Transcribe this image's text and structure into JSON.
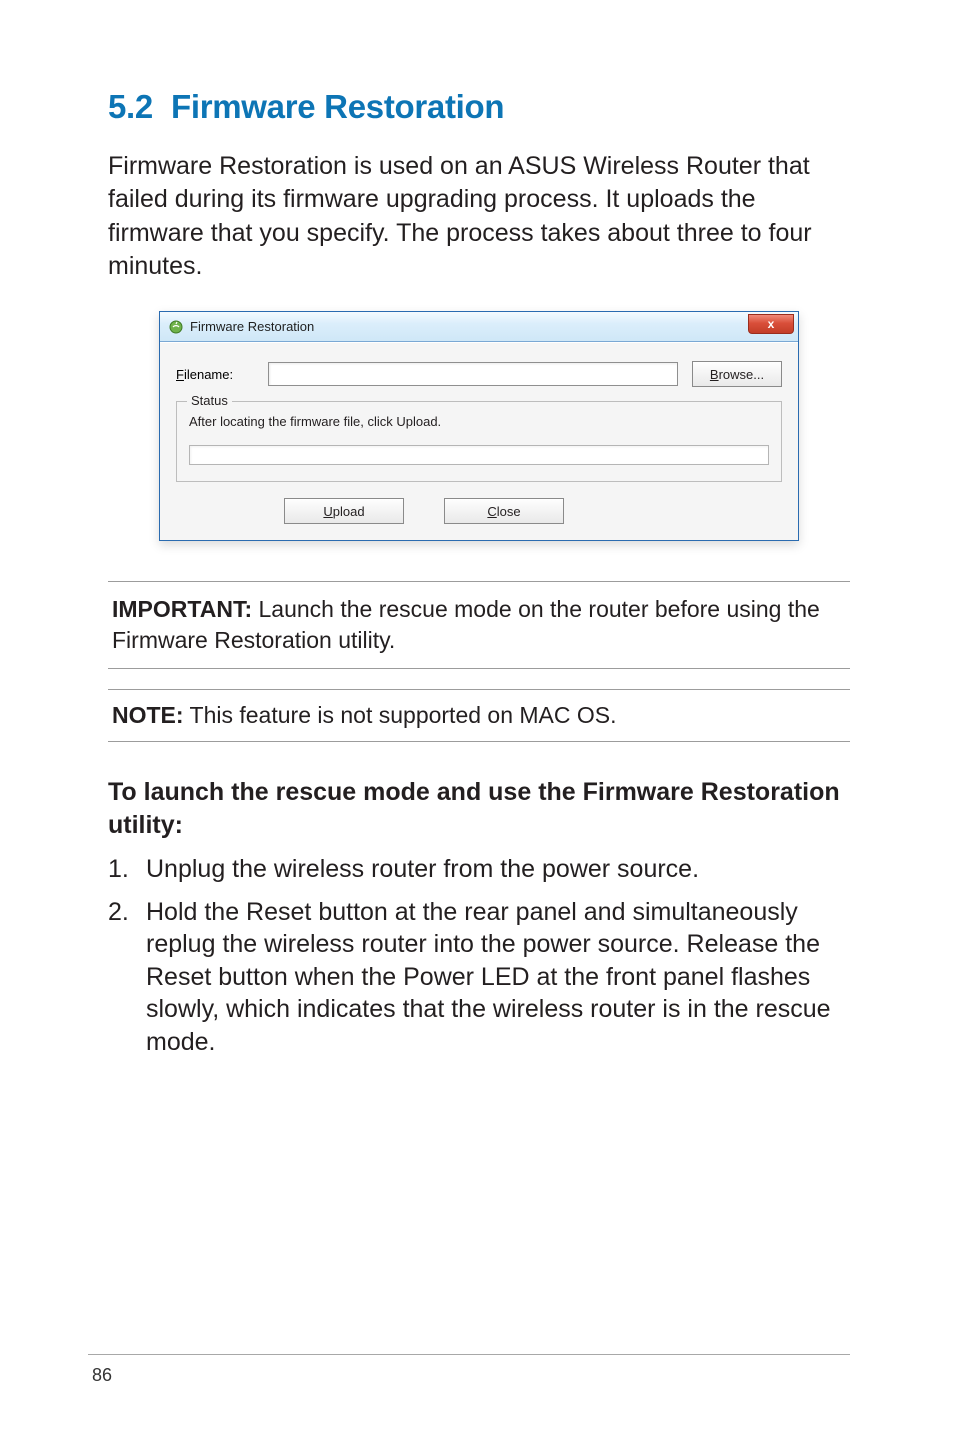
{
  "heading": {
    "number": "5.2",
    "title": "Firmware Restoration"
  },
  "intro": "Firmware Restoration is used on an ASUS Wireless Router that failed during its firmware upgrading process. It uploads the firmware that you specify. The process takes about three to four minutes.",
  "dialog": {
    "title": "Firmware Restoration",
    "filename_label_pre": "F",
    "filename_label_rest": "ilename:",
    "filename_value": "",
    "browse_pre": "B",
    "browse_rest": "rowse...",
    "status_legend": "Status",
    "status_text": "After locating the firmware file, click Upload.",
    "upload_pre": "U",
    "upload_rest": "pload",
    "close_pre": "C",
    "close_rest": "lose",
    "close_x": "x"
  },
  "important": {
    "label": "IMPORTANT:",
    "text": "  Launch the rescue mode on the router before using the Firmware Restoration utility."
  },
  "note": {
    "label": "NOTE:",
    "text": "  This feature is not supported on MAC OS."
  },
  "subheading": "To launch the rescue mode and use the Firmware Restoration utility:",
  "steps": [
    "Unplug the wireless router from the power source.",
    "Hold the Reset button at the rear panel and simultaneously replug the wireless router into the power source. Release the Reset button when the Power LED at the front panel flashes slowly, which indicates that the wireless router is in the rescue mode."
  ],
  "page_number": "86"
}
